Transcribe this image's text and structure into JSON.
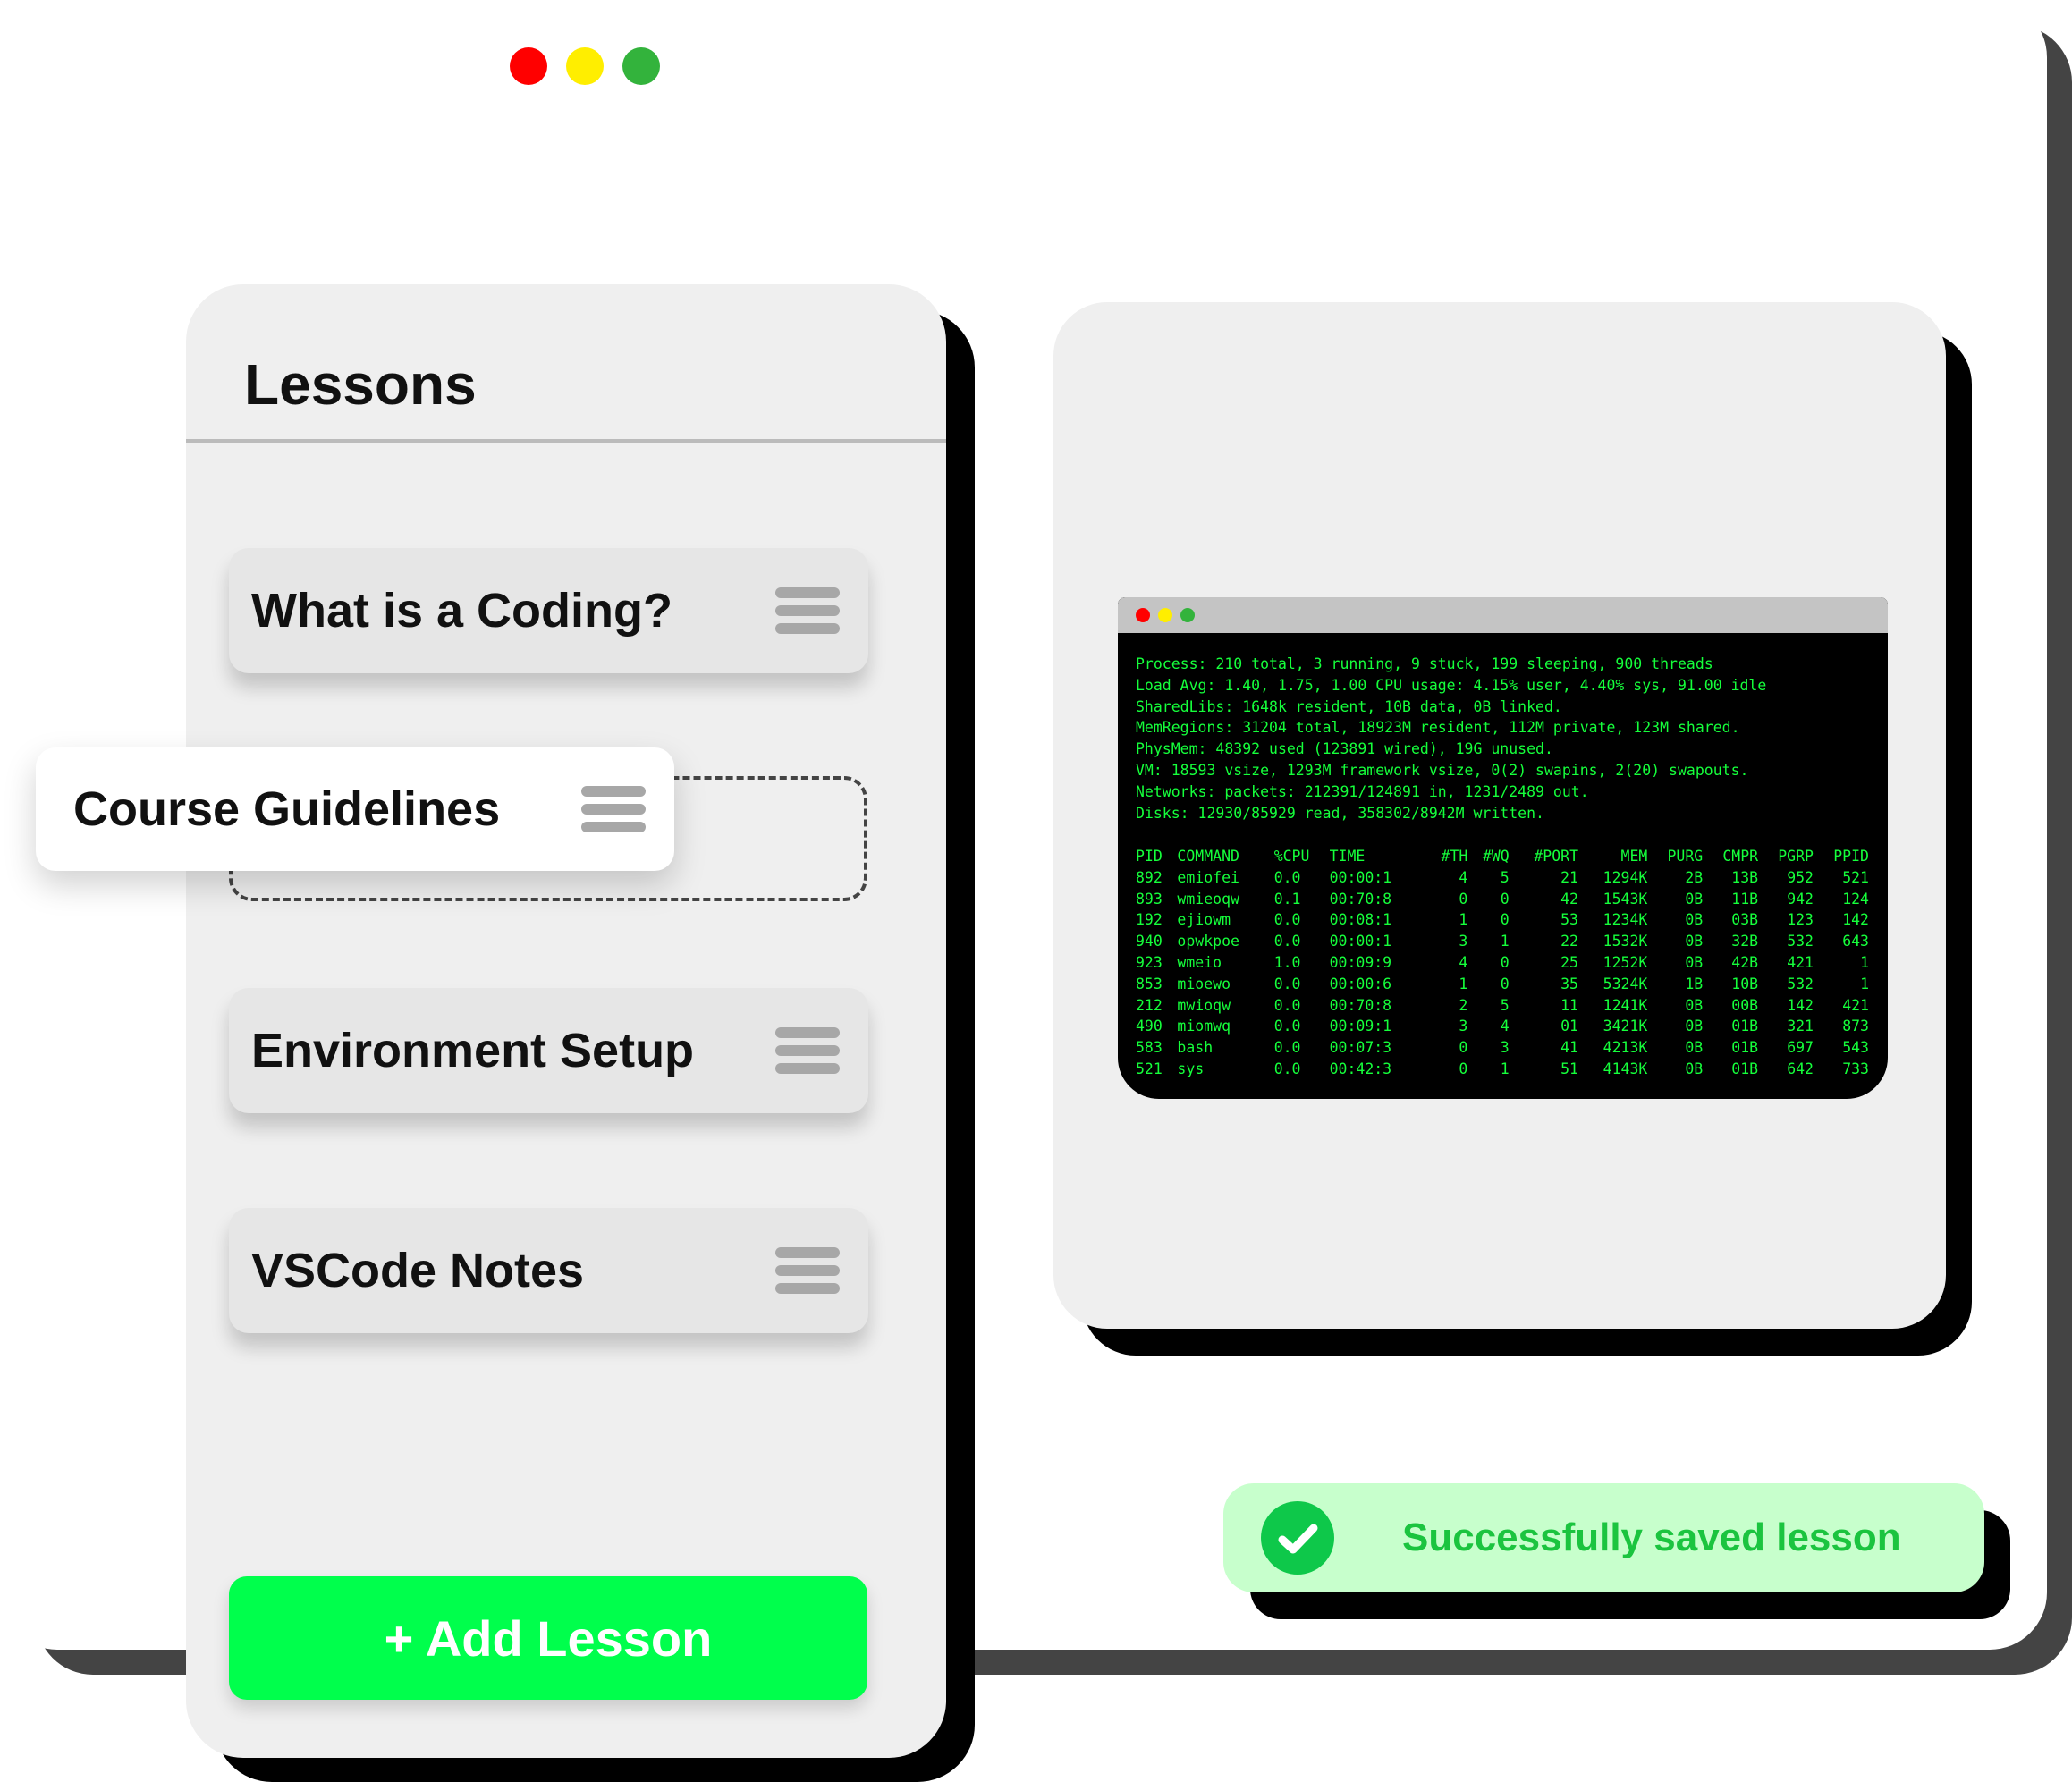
{
  "colors": {
    "traffic_red": "#ff0000",
    "traffic_yellow": "#ffee00",
    "traffic_green": "#33b33c",
    "add_button": "#00ff4c",
    "terminal_text": "#15ff3b",
    "toast_bg": "#c7ffcc",
    "toast_text": "#1bc43f"
  },
  "lessons": {
    "title": "Lessons",
    "items": [
      {
        "label": "What is a Coding?"
      },
      {
        "label": "Environment Setup"
      },
      {
        "label": "VSCode Notes"
      }
    ],
    "dragging": {
      "label": "Course Guidelines"
    },
    "add_button_label": "+ Add Lesson"
  },
  "terminal": {
    "header_lines": [
      "Process: 210 total, 3 running, 9 stuck, 199 sleeping, 900 threads",
      "Load Avg: 1.40, 1.75, 1.00 CPU usage: 4.15% user, 4.40% sys, 91.00 idle",
      "SharedLibs: 1648k resident, 10B data, 0B linked.",
      "MemRegions: 31204 total, 18923M resident, 112M private, 123M shared.",
      "PhysMem: 48392 used (123891 wired), 19G unused.",
      "VM: 18593 vsize, 1293M framework vsize, 0(2) swapins, 2(20) swapouts.",
      "Networks: packets: 212391/124891 in, 1231/2489 out.",
      "Disks: 12930/85929 read, 358302/8942M written."
    ],
    "columns": [
      "PID",
      "COMMAND",
      "%CPU",
      "TIME",
      "#TH",
      "#WQ",
      "#PORT",
      "MEM",
      "PURG",
      "CMPR",
      "PGRP",
      "PPID"
    ],
    "rows": [
      [
        "892",
        "emiofei",
        "0.0",
        "00:00:1",
        "4",
        "5",
        "21",
        "1294K",
        "2B",
        "13B",
        "952",
        "521"
      ],
      [
        "893",
        "wmieoqw",
        "0.1",
        "00:70:8",
        "0",
        "0",
        "42",
        "1543K",
        "0B",
        "11B",
        "942",
        "124"
      ],
      [
        "192",
        "ejiowm",
        "0.0",
        "00:08:1",
        "1",
        "0",
        "53",
        "1234K",
        "0B",
        "03B",
        "123",
        "142"
      ],
      [
        "940",
        "opwkpoe",
        "0.0",
        "00:00:1",
        "3",
        "1",
        "22",
        "1532K",
        "0B",
        "32B",
        "532",
        "643"
      ],
      [
        "923",
        "wmeio",
        "1.0",
        "00:09:9",
        "4",
        "0",
        "25",
        "1252K",
        "0B",
        "42B",
        "421",
        "1"
      ],
      [
        "853",
        "mioewo",
        "0.0",
        "00:00:6",
        "1",
        "0",
        "35",
        "5324K",
        "1B",
        "10B",
        "532",
        "1"
      ],
      [
        "212",
        "mwioqw",
        "0.0",
        "00:70:8",
        "2",
        "5",
        "11",
        "1241K",
        "0B",
        "00B",
        "142",
        "421"
      ],
      [
        "490",
        "miomwq",
        "0.0",
        "00:09:1",
        "3",
        "4",
        "01",
        "3421K",
        "0B",
        "01B",
        "321",
        "873"
      ],
      [
        "583",
        "bash",
        "0.0",
        "00:07:3",
        "0",
        "3",
        "41",
        "4213K",
        "0B",
        "01B",
        "697",
        "543"
      ],
      [
        "521",
        "sys",
        "0.0",
        "00:42:3",
        "0",
        "1",
        "51",
        "4143K",
        "0B",
        "01B",
        "642",
        "733"
      ]
    ]
  },
  "toast": {
    "message": "Successfully saved lesson",
    "icon": "check-circle-icon"
  }
}
